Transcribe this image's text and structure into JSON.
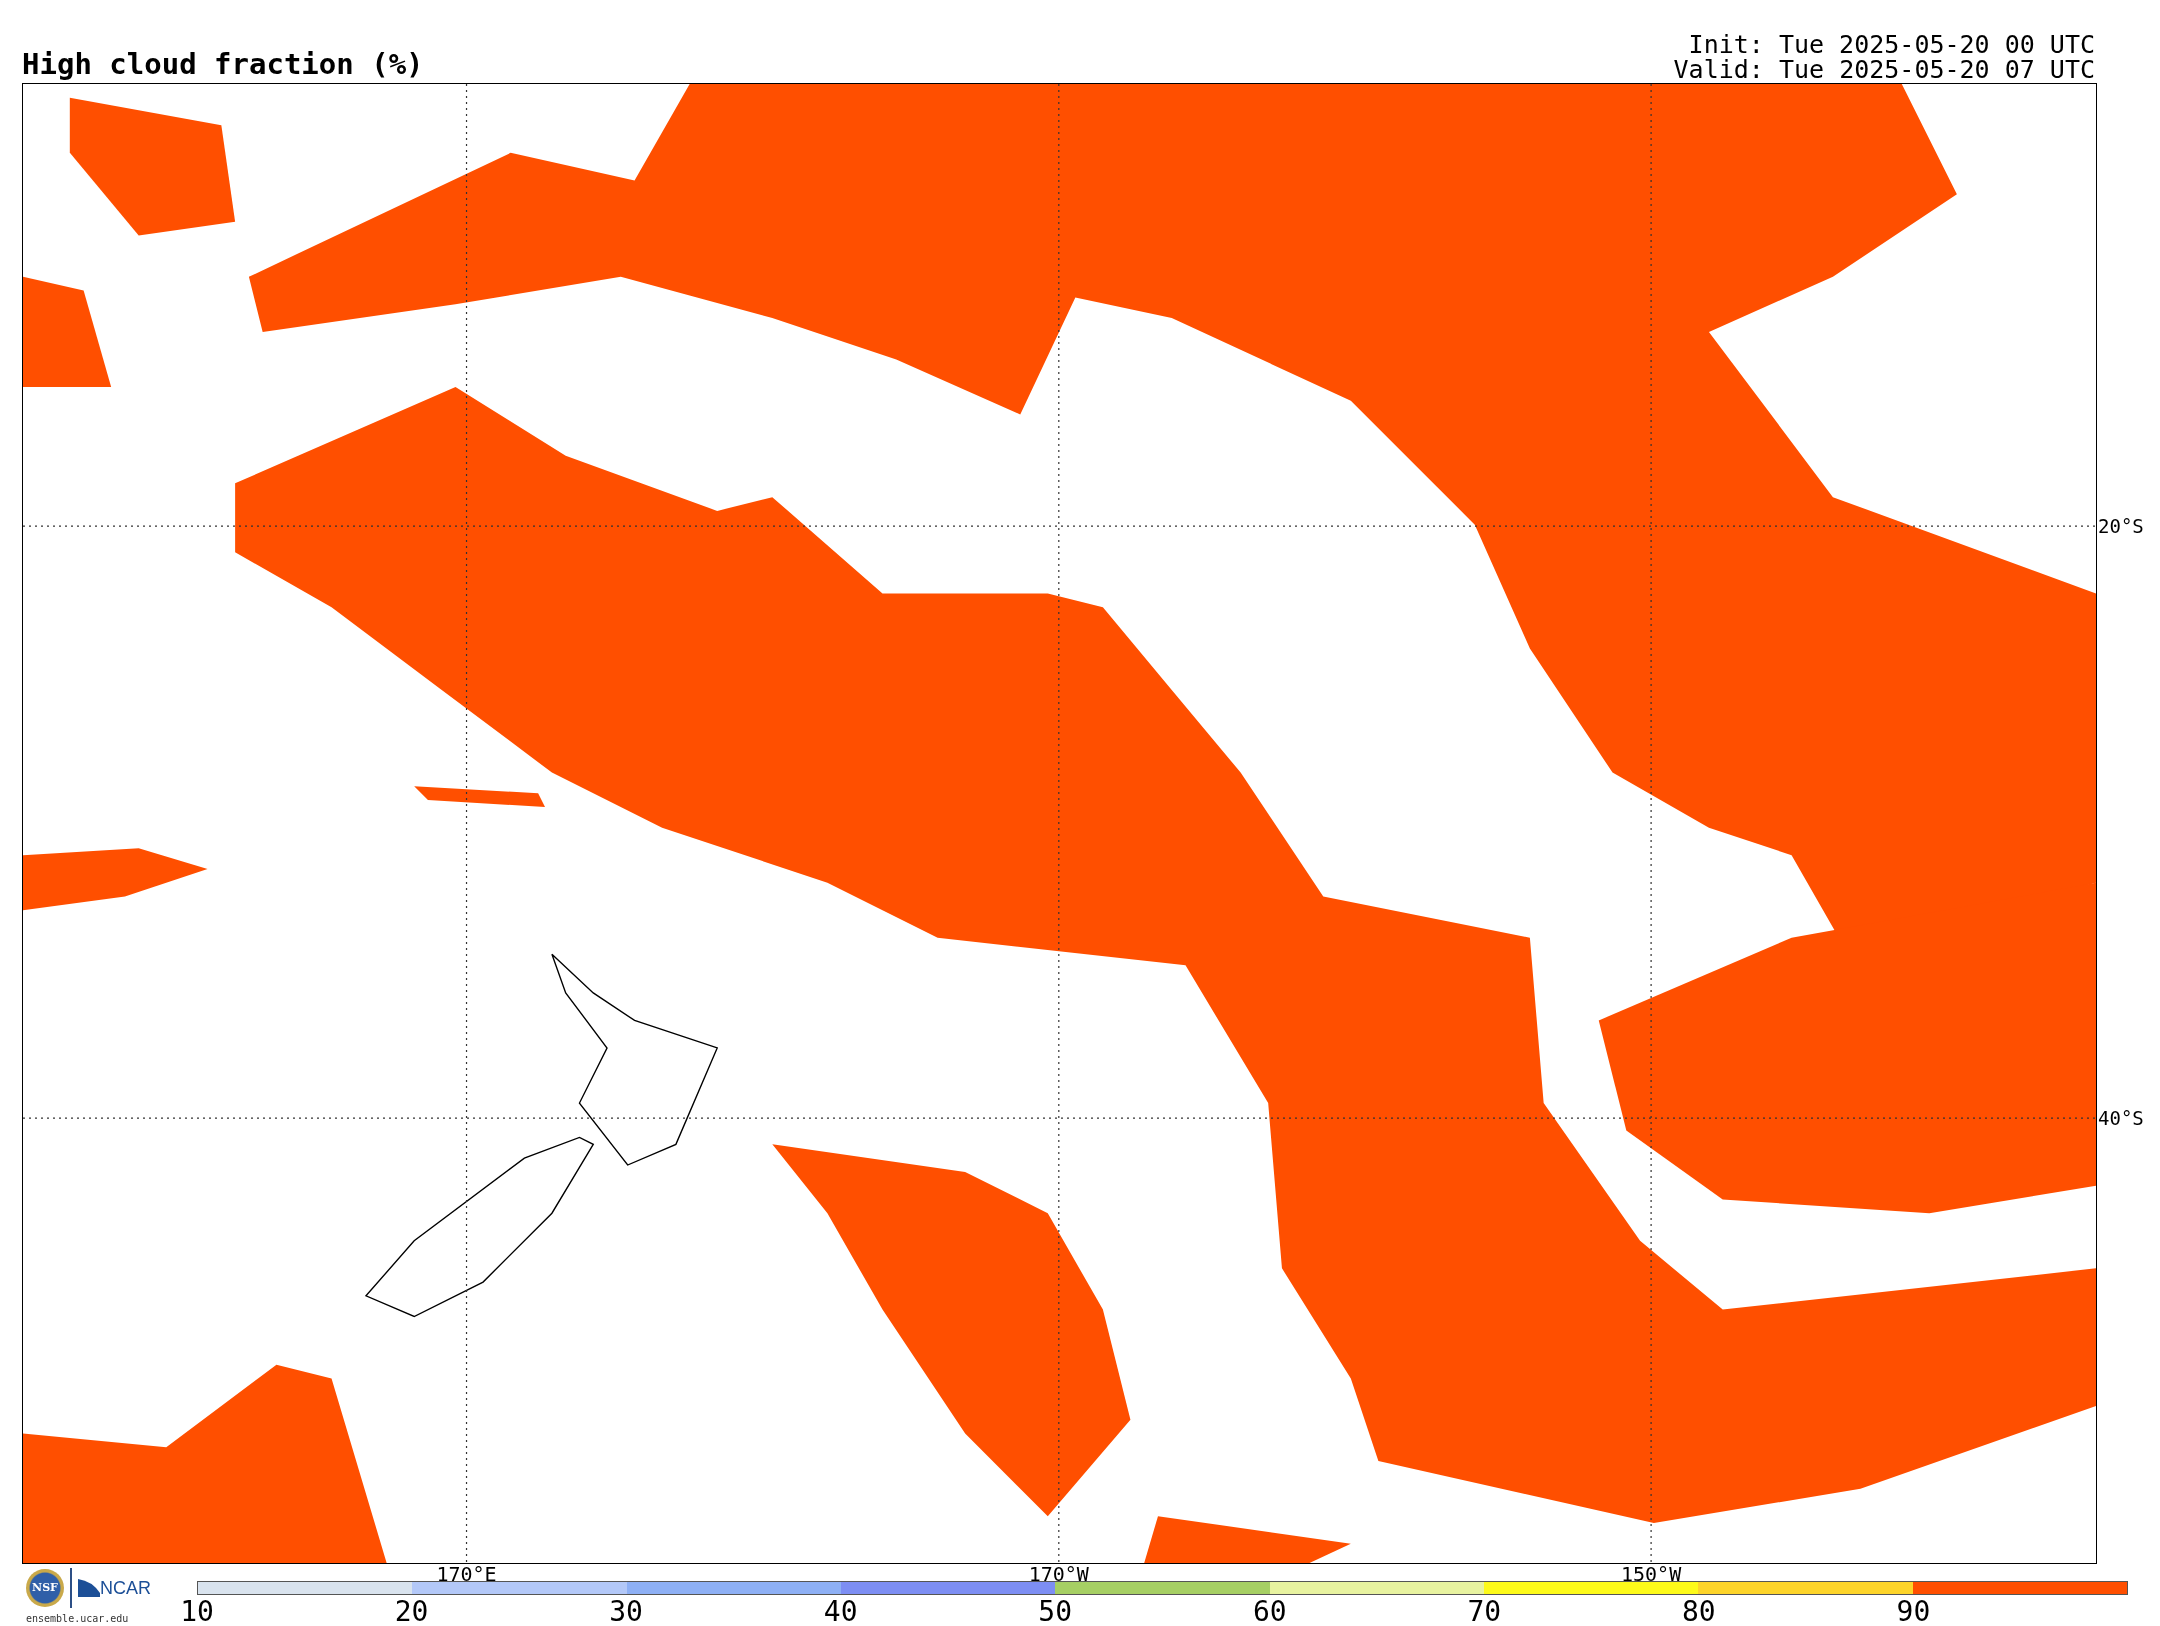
{
  "title": "High cloud fraction (%)",
  "init": "Init: Tue 2025-05-20 00 UTC",
  "valid": "Valid: Tue 2025-05-20 07 UTC",
  "map": {
    "lat_labels": [
      "20°S",
      "40°S"
    ],
    "lon_labels": [
      "170°E",
      "170°W",
      "150°W"
    ]
  },
  "colorbar": {
    "bins": [
      {
        "color": "#d9e3ee"
      },
      {
        "color": "#b3c8f8"
      },
      {
        "color": "#8eb0f5"
      },
      {
        "color": "#7d8ef3"
      },
      {
        "color": "#a6cf64"
      },
      {
        "color": "#e8f3a0"
      },
      {
        "color": "#fdfa1a"
      },
      {
        "color": "#fdd42a"
      },
      {
        "color": "#ff4f00"
      }
    ],
    "ticks": [
      "10",
      "20",
      "30",
      "40",
      "50",
      "60",
      "70",
      "80",
      "90"
    ]
  },
  "footer": {
    "nsf_logo": "NSF",
    "ncar_logo": "NCAR",
    "site": "ensemble.ucar.edu"
  }
}
